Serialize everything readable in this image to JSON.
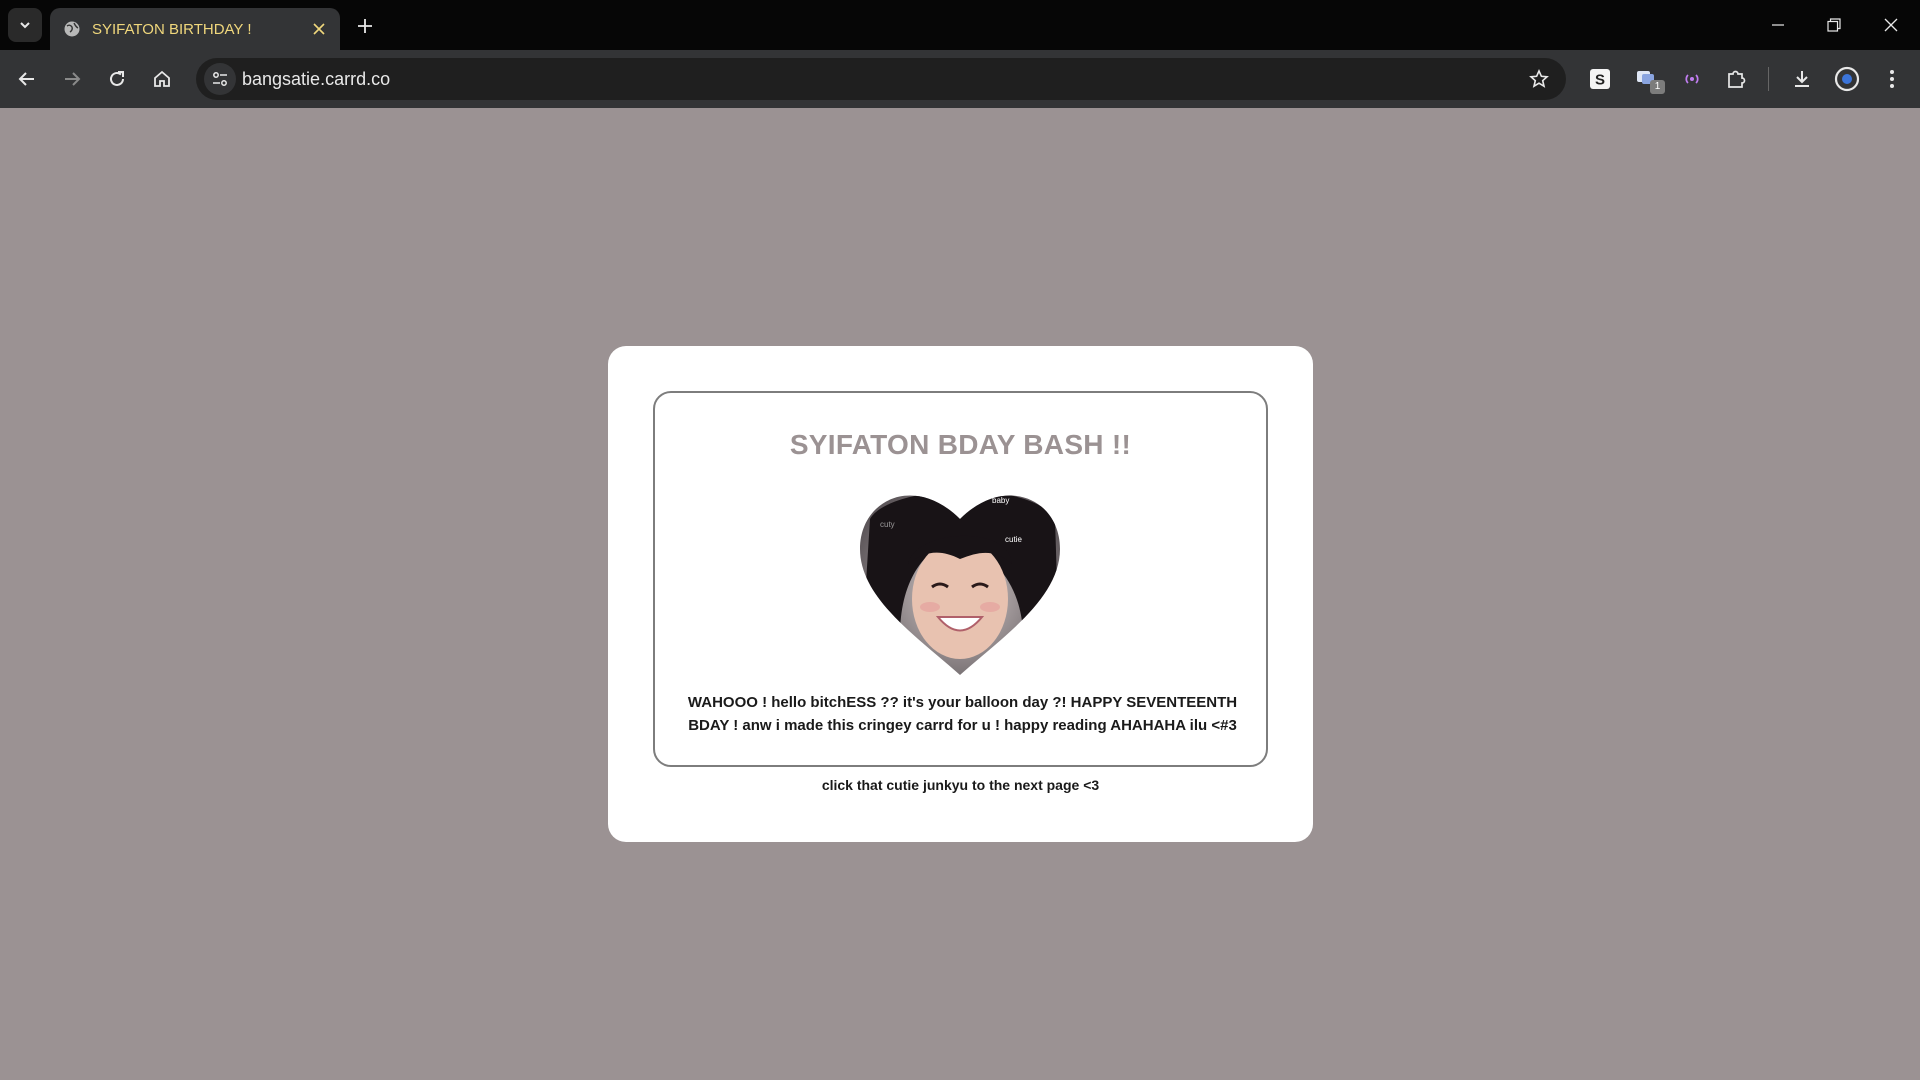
{
  "browser": {
    "tab_title": "SYIFATON BIRTHDAY !",
    "url": "bangsatie.carrd.co",
    "extension_badge": "1"
  },
  "page": {
    "headline": "SYIFATON BDAY BASH !!",
    "message": "WAHOOO ! hello bitchESS ?? it's your balloon day ?! HAPPY SEVENTEENTH BDAY ! anw i made this cringey carrd for u ! happy reading AHAHAHA ilu <#3",
    "photo_captions": [
      "baby",
      "cutie",
      "cuty"
    ],
    "next_hint": "click that cutie junkyu to the next page <3"
  },
  "colors": {
    "page_background": "#9b9293",
    "headline": "#9b9293",
    "tab_title": "#f0d77c"
  }
}
